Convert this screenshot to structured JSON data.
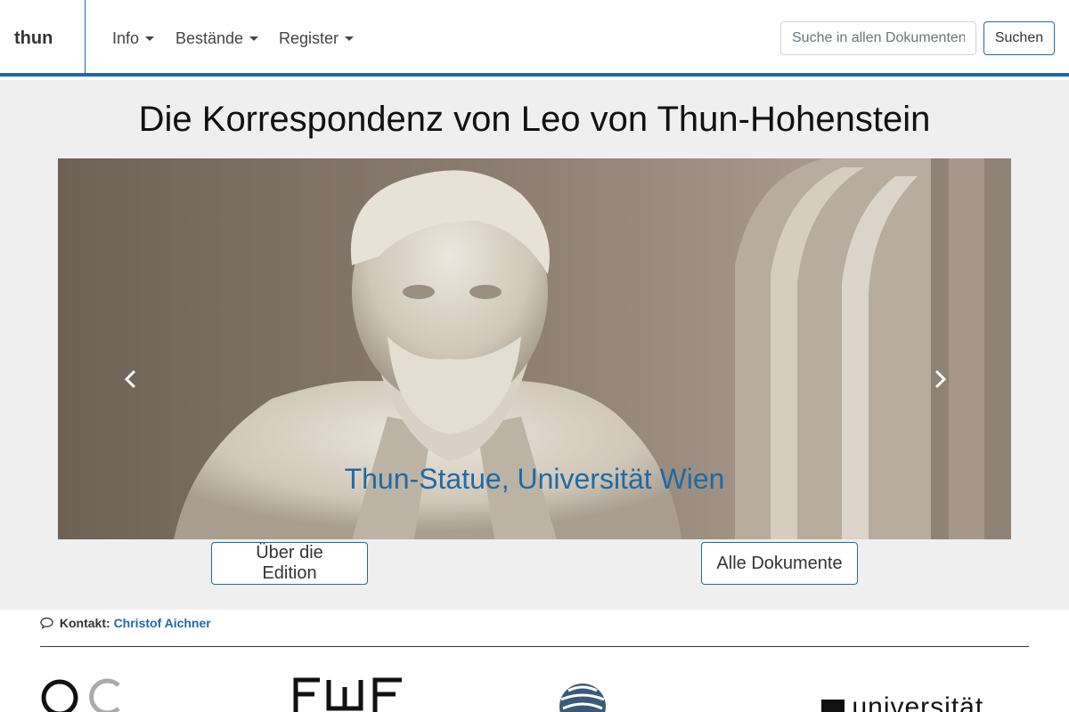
{
  "navbar": {
    "brand": "thun",
    "menu": [
      {
        "label": "Info"
      },
      {
        "label": "Bestände"
      },
      {
        "label": "Register"
      }
    ],
    "search": {
      "placeholder": "Suche in allen Dokumenten",
      "button_label": "Suchen"
    }
  },
  "hero": {
    "title": "Die Korrespondenz von Leo von Thun-Hohenstein",
    "carousel": {
      "caption": "Thun-Statue, Universität Wien",
      "prev_label": "Previous",
      "next_label": "Next"
    },
    "buttons": {
      "about": "Über die Edition",
      "all_docs": "Alle Dokumente"
    }
  },
  "footer": {
    "contact_label": "Kontakt:",
    "contact_name": "Christof Aichner",
    "logos": [
      "acdh-logo",
      "fwf-logo",
      "globe-logo",
      "universitaet-logo"
    ],
    "univ_text": "universität"
  },
  "colors": {
    "accent": "#1f6aa5",
    "hero_bg": "#efefef"
  }
}
